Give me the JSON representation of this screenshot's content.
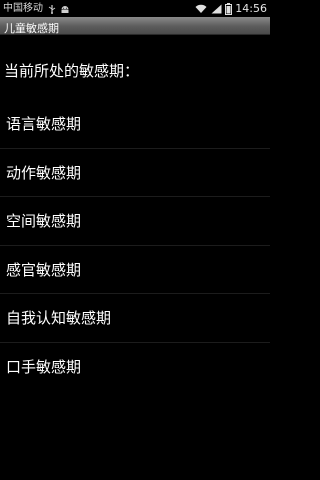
{
  "status_bar": {
    "carrier": "中国移动",
    "time": "14:56",
    "icons": [
      "usb-icon",
      "android-icon",
      "wifi-icon",
      "signal-icon",
      "battery-icon"
    ]
  },
  "app": {
    "title": "儿童敏感期"
  },
  "content": {
    "heading": "当前所处的敏感期：",
    "items": [
      {
        "label": "语言敏感期"
      },
      {
        "label": "动作敏感期"
      },
      {
        "label": "空间敏感期"
      },
      {
        "label": "感官敏感期"
      },
      {
        "label": "自我认知敏感期"
      },
      {
        "label": "口手敏感期"
      }
    ]
  },
  "colors": {
    "background": "#000000",
    "text": "#ffffff",
    "title_bar": "#5c5c5c",
    "divider": "#1c1c1c"
  }
}
